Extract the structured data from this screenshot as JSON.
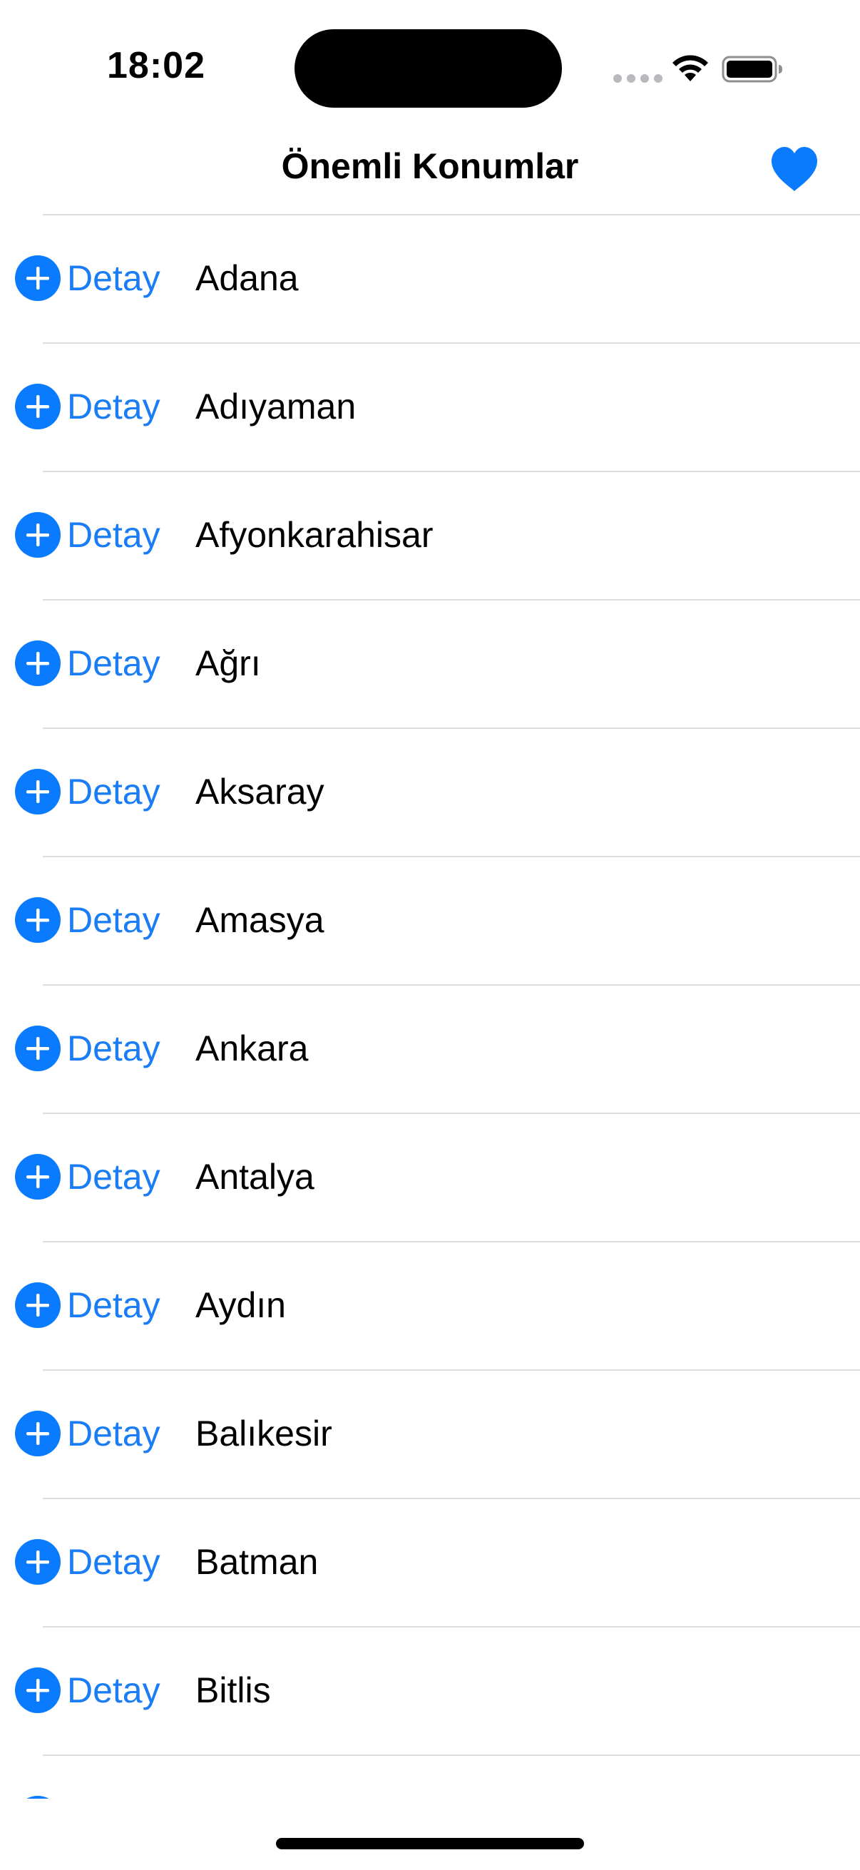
{
  "status_bar": {
    "time": "18:02",
    "wifi_icon": "wifi-icon",
    "battery_icon": "battery-full-icon"
  },
  "nav": {
    "title": "Önemli Konumlar",
    "favorite_icon": "heart-fill-icon",
    "accent_color": "#0a7aff"
  },
  "list": {
    "detail_label": "Detay",
    "add_icon": "plus-circle-fill-icon",
    "items": [
      {
        "name": "Adana"
      },
      {
        "name": "Adıyaman"
      },
      {
        "name": "Afyonkarahisar"
      },
      {
        "name": "Ağrı"
      },
      {
        "name": "Aksaray"
      },
      {
        "name": "Amasya"
      },
      {
        "name": "Ankara"
      },
      {
        "name": "Antalya"
      },
      {
        "name": "Aydın"
      },
      {
        "name": "Balıkesir"
      },
      {
        "name": "Batman"
      },
      {
        "name": "Bitlis"
      }
    ]
  }
}
